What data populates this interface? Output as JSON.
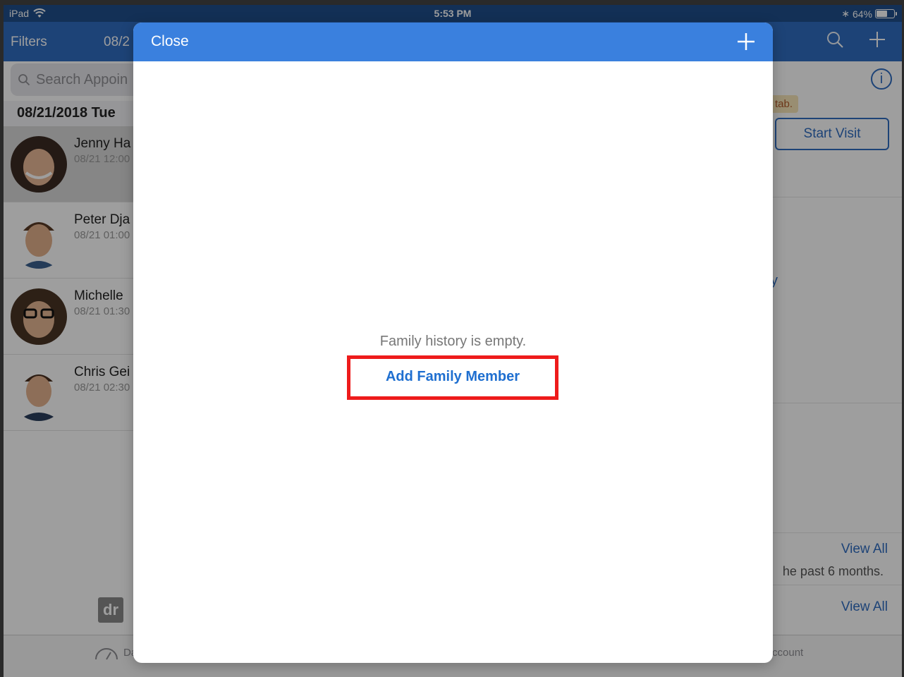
{
  "status_bar": {
    "device": "iPad",
    "time": "5:53 PM",
    "battery": "64%",
    "battery_level": 0.64
  },
  "nav": {
    "filters_label": "Filters",
    "date_partial": "08/2"
  },
  "search": {
    "placeholder": "Search Appoin"
  },
  "list": {
    "date_header": "08/21/2018 Tue",
    "appointments": [
      {
        "name": "Jenny Ha",
        "time": "08/21 12:00",
        "selected": true
      },
      {
        "name": "Peter Dja",
        "time": "08/21 01:00",
        "selected": false
      },
      {
        "name": "Michelle",
        "time": "08/21 01:30",
        "selected": false
      },
      {
        "name": "Chris Gei",
        "time": "08/21 02:30",
        "selected": false
      }
    ]
  },
  "detail": {
    "tab_note": "tab.",
    "start_visit_label": "Start Visit",
    "stray_text": "y",
    "view_all_1": "View All",
    "view_all_2": "View All",
    "past_note": "he past 6 months.",
    "logo_text": "dr"
  },
  "tabbar": {
    "items": [
      {
        "label": "Da",
        "icon": "dashboard-icon"
      },
      {
        "label": "",
        "icon": "calendar-icon"
      },
      {
        "label": "",
        "icon": "messages-icon"
      },
      {
        "label": "",
        "icon": "tasks-icon"
      },
      {
        "label": "Account",
        "icon": "account-icon"
      }
    ]
  },
  "modal": {
    "close_label": "Close",
    "empty_message": "Family history is empty.",
    "add_family_label": "Add Family Member",
    "highlight_color": "#ee1b1b",
    "header_color": "#3a80de"
  }
}
